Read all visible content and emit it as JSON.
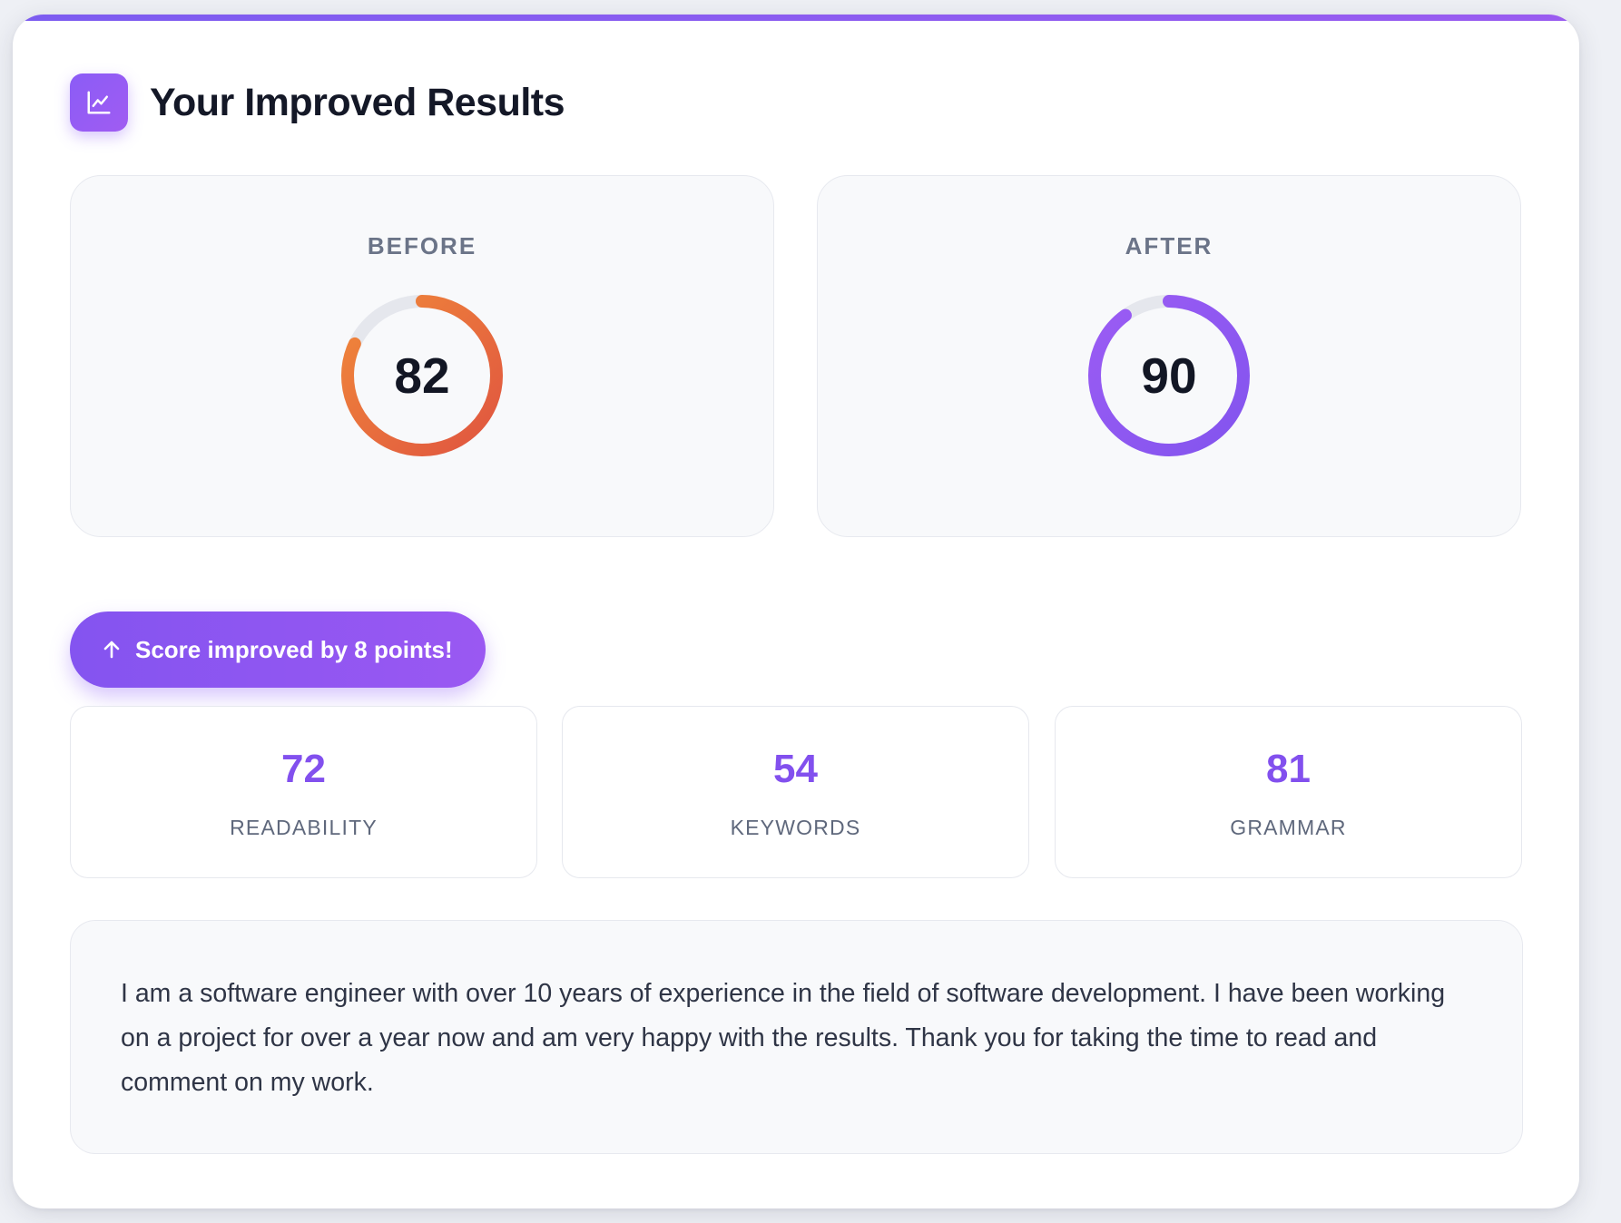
{
  "header": {
    "icon": "line-chart-icon",
    "title": "Your Improved Results"
  },
  "scores": {
    "before": {
      "label": "BEFORE",
      "value": "82",
      "percent": 82,
      "colors": [
        "#f0883a",
        "#e05540"
      ]
    },
    "after": {
      "label": "AFTER",
      "value": "90",
      "percent": 90,
      "colors": [
        "#9b5cf4",
        "#8354ee"
      ]
    },
    "track_color": "#e5e7ed"
  },
  "improvement": {
    "icon": "arrow-up-icon",
    "label": "Score improved by 8 points!"
  },
  "metrics": [
    {
      "value": "72",
      "label": "READABILITY"
    },
    {
      "value": "54",
      "label": "KEYWORDS"
    },
    {
      "value": "81",
      "label": "GRAMMAR"
    }
  ],
  "summary": {
    "text": "I am a software engineer with over 10 years of experience in the field of software development. I have been working on a project for over a year now and am very happy with the results. Thank you for taking the time to read and comment on my work."
  },
  "colors": {
    "accent": "#8b5cf6",
    "metric_value": "#8250ee"
  }
}
